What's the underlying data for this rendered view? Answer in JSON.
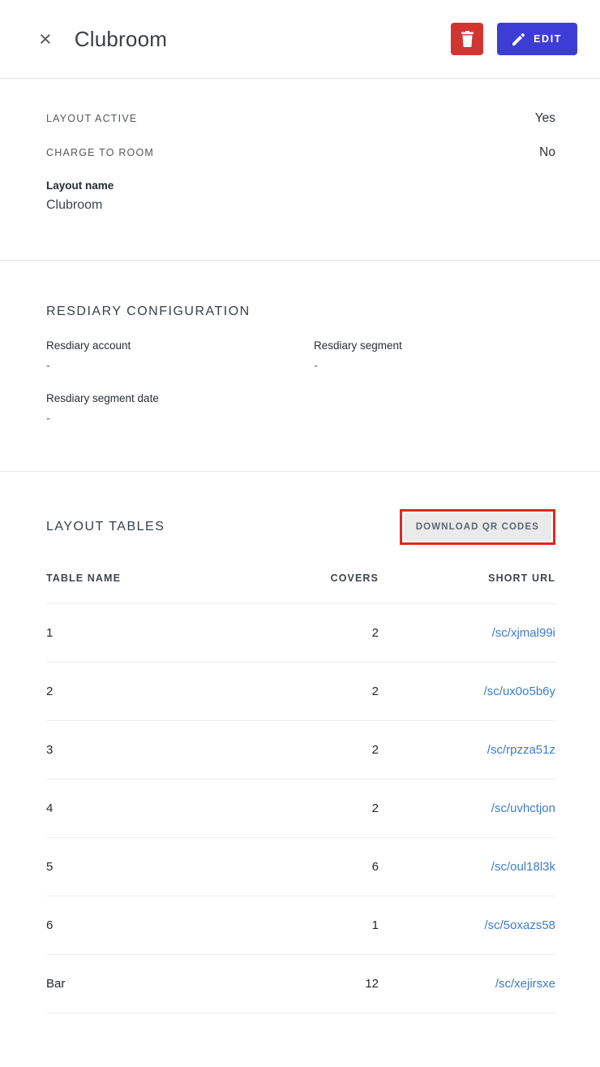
{
  "header": {
    "title": "Clubroom",
    "close_glyph": "×",
    "edit_label": "EDIT"
  },
  "details": {
    "rows": [
      {
        "label": "LAYOUT ACTIVE",
        "value": "Yes"
      },
      {
        "label": "CHARGE TO ROOM",
        "value": "No"
      }
    ],
    "layout_name": {
      "label": "Layout name",
      "value": "Clubroom"
    }
  },
  "resdiary": {
    "heading": "RESDIARY CONFIGURATION",
    "fields": [
      {
        "label": "Resdiary account",
        "value": "-"
      },
      {
        "label": "Resdiary segment",
        "value": "-"
      },
      {
        "label": "Resdiary segment date",
        "value": "-"
      }
    ]
  },
  "tables": {
    "heading": "LAYOUT TABLES",
    "download_label": "DOWNLOAD QR CODES",
    "columns": [
      "TABLE NAME",
      "COVERS",
      "SHORT URL"
    ],
    "rows": [
      {
        "name": "1",
        "covers": "2",
        "short_url": "/sc/xjmal99i"
      },
      {
        "name": "2",
        "covers": "2",
        "short_url": "/sc/ux0o5b6y"
      },
      {
        "name": "3",
        "covers": "2",
        "short_url": "/sc/rpzza51z"
      },
      {
        "name": "4",
        "covers": "2",
        "short_url": "/sc/uvhctjon"
      },
      {
        "name": "5",
        "covers": "6",
        "short_url": "/sc/oul18l3k"
      },
      {
        "name": "6",
        "covers": "1",
        "short_url": "/sc/5oxazs58"
      },
      {
        "name": "Bar",
        "covers": "12",
        "short_url": "/sc/xejirsxe"
      }
    ]
  },
  "colors": {
    "delete_button": "#d23430",
    "edit_button": "#3d3dd6",
    "link": "#3d7cc9",
    "highlight_border": "#e3261d",
    "qr_button_bg": "#eaeaea"
  }
}
